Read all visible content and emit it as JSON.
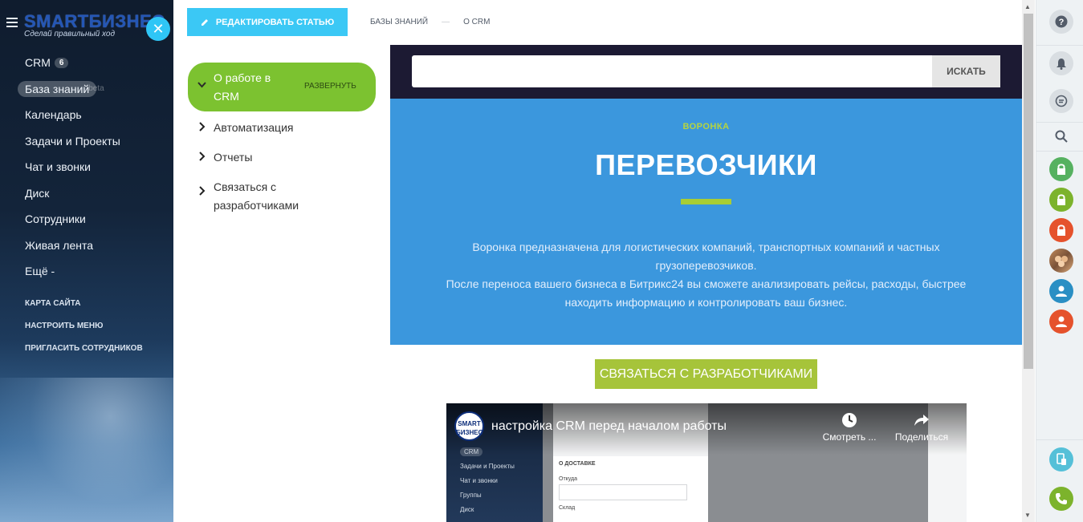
{
  "sidebar": {
    "logo_main": "SMARTБИЗНЕС",
    "logo_sub": "Сделай правильный ход",
    "items": [
      {
        "label": "CRM",
        "counter": "6"
      },
      {
        "label": "База знаний",
        "badge": "beta"
      },
      {
        "label": "Календарь"
      },
      {
        "label": "Задачи и Проекты"
      },
      {
        "label": "Чат и звонки"
      },
      {
        "label": "Диск"
      },
      {
        "label": "Сотрудники"
      },
      {
        "label": "Живая лента"
      },
      {
        "label": "Ещё -"
      }
    ],
    "links": [
      "КАРТА САЙТА",
      "НАСТРОИТЬ МЕНЮ",
      "ПРИГЛАСИТЬ СОТРУДНИКОВ"
    ]
  },
  "toolbar": {
    "edit_label": "РЕДАКТИРОВАТЬ СТАТЬЮ",
    "breadcrumb": [
      "БАЗЫ ЗНАНИЙ",
      "—",
      "О CRM"
    ]
  },
  "tree": {
    "active": {
      "label": "О работе в CRM",
      "action": "РАЗВЕРНУТЬ"
    },
    "items": [
      "Автоматизация",
      "Отчеты",
      "Связаться с разработчиками"
    ]
  },
  "search": {
    "placeholder": "",
    "button": "ИСКАТЬ"
  },
  "hero": {
    "kicker": "ВОРОНКА",
    "title": "ПЕРЕВОЗЧИКИ",
    "desc_1": "Воронка предназначена для логистических компаний, транспортных компаний и частных грузоперевозчиков.",
    "desc_2": "После переноса вашего бизнеса в Битрикс24 вы сможете анализировать рейсы,  расходы, быстрее находить информацию и контролировать ваш бизнес."
  },
  "contact_button": "СВЯЗАТЬСЯ С РАЗРАБОТЧИКАМИ",
  "video": {
    "channel_logo": "SMART БИЗНЕС",
    "title": "настройка CRM перед началом работы",
    "watch_later": "Смотреть ...",
    "share": "Поделиться",
    "inner_menu": [
      "CRM",
      "Задачи и Проекты",
      "Чат и звонки",
      "Группы",
      "Диск"
    ],
    "inner_form": {
      "header": "О ДОСТАВКЕ",
      "field_1": "Откуда",
      "field_2": "Склад"
    }
  },
  "colors": {
    "accent_blue": "#3bc8f5",
    "tree_active_green": "#7cc230",
    "hero_blue": "#3b97dd",
    "contact_green": "#a6c43a",
    "lock_green": "#56b160",
    "lock_red": "#e5522c",
    "user_teal": "#2a8fc4"
  }
}
